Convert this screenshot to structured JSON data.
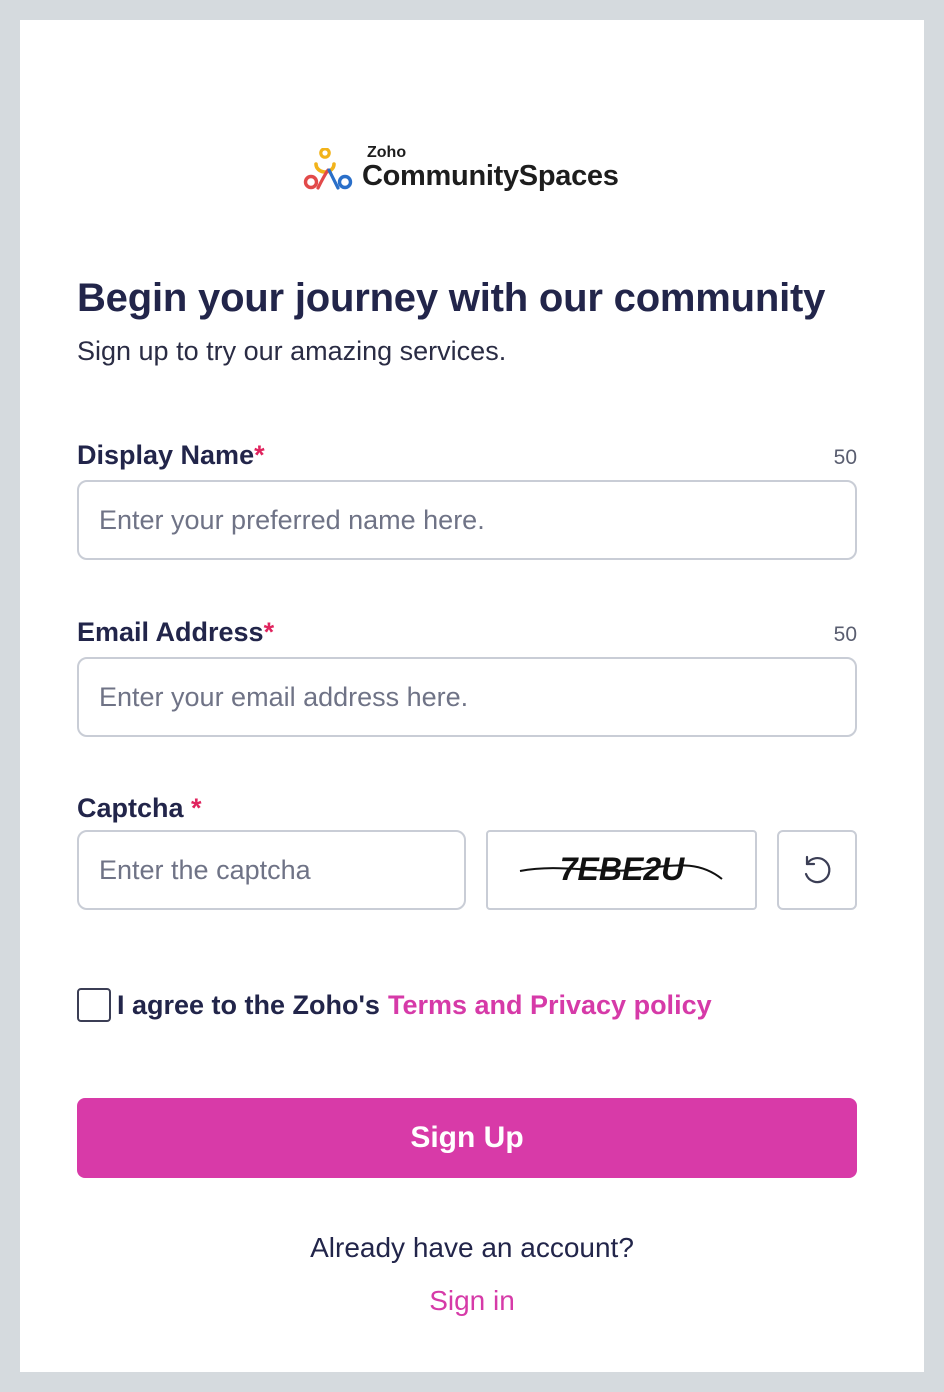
{
  "logo": {
    "brand_small": "Zoho",
    "brand_big": "CommunitySpaces"
  },
  "heading": {
    "title": "Begin your journey with our community",
    "subtitle": "Sign up to try our amazing services."
  },
  "form": {
    "display_name": {
      "label": "Display Name",
      "required_mark": "*",
      "char_limit": "50",
      "placeholder": "Enter your preferred name here.",
      "value": ""
    },
    "email": {
      "label": "Email Address",
      "required_mark": "*",
      "char_limit": "50",
      "placeholder": "Enter your email address here.",
      "value": ""
    },
    "captcha": {
      "label": "Captcha",
      "required_mark": "*",
      "placeholder": "Enter the captcha",
      "value": "",
      "image_text": "7EBE2U",
      "refresh_icon": "refresh-icon"
    },
    "agree": {
      "checked": false,
      "text": "I agree to the Zoho's",
      "link_text": "Terms and Privacy policy"
    },
    "submit_label": "Sign Up"
  },
  "footer": {
    "already_text": "Already have an account?",
    "signin_link": "Sign in"
  },
  "colors": {
    "accent": "#d83aa8",
    "required": "#e0245e",
    "heading": "#22254a",
    "page_bg": "#d5dade"
  }
}
